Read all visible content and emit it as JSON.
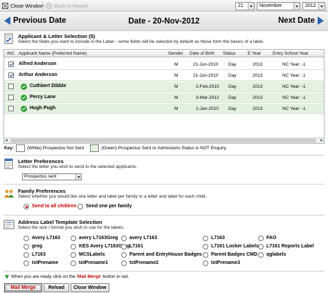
{
  "toolbar": {
    "close_label": "Close Window",
    "back_label": "Back to Report",
    "day": "21",
    "month": "November",
    "year": "2012"
  },
  "datebar": {
    "prev_label": "Previous Date",
    "title": "Date - 20-Nov-2012",
    "next_label": "Next Date"
  },
  "applicants": {
    "title": "Applicant & Letter Selection (5)",
    "description": "Select the fields you want to include in the Label - some fields will be selected by default as these form the basics of a label.",
    "columns": [
      "INC",
      "Applicant Name (Preferred Name)",
      "Gender",
      "Date of Birth",
      "Status",
      "E Year",
      "Entry School Year"
    ],
    "rows": [
      {
        "name": "Alfred Anderson",
        "gender": "M",
        "dob": "21-Jun-2010",
        "status": "Day",
        "eyear": "2013",
        "entry": "NC Year: -1",
        "checked": true,
        "prospectus": false
      },
      {
        "name": "Arthur Anderson",
        "gender": "M",
        "dob": "21-Jun-2010",
        "status": "Day",
        "eyear": "2013",
        "entry": "NC Year: -1",
        "checked": true,
        "prospectus": false
      },
      {
        "name": "Cuthbert Dibble",
        "gender": "M",
        "dob": "2-Feb-2010",
        "status": "Day",
        "eyear": "2013",
        "entry": "NC Year: -1",
        "checked": false,
        "prospectus": true
      },
      {
        "name": "Percy Lane",
        "gender": "M",
        "dob": "3-Mar-2012",
        "status": "Day",
        "eyear": "2013",
        "entry": "NC Year: -1",
        "checked": false,
        "prospectus": true
      },
      {
        "name": "Hugh Pugh",
        "gender": "M",
        "dob": "1-Jan-2010",
        "status": "Day",
        "eyear": "2013",
        "entry": "NC Year: -1",
        "checked": false,
        "prospectus": true
      }
    ]
  },
  "key": {
    "label": "Key:",
    "white_text": "(White) Prospectus Not Sent",
    "green_text": "(Green) Prospectus Sent or Admissions Status is NOT Enquiry."
  },
  "letter": {
    "title": "Letter Preferences",
    "description": "Select the letter you wish to send to the selected applicants.",
    "selected": "Prospectus sent"
  },
  "family": {
    "title": "Family Preferences",
    "description": "Select whether you would like one letter and label per family or a letter and label for each child.",
    "option_all": "Send to all children",
    "option_one": "Send one per family"
  },
  "template": {
    "title": "Address Label Template Selection",
    "description": "Select the size / format you wish to use for the labels.",
    "options": [
      [
        "Avery L7163",
        "avery L7163Greg",
        "avery L7163",
        "L7163",
        "FAO"
      ],
      [
        "greg",
        "KES Avery L7163Greg",
        "L7161",
        "L7161 Locker Labels",
        "L7161 Reports Label"
      ],
      [
        "L7163",
        "MCSLabels",
        "Parent and EntryHouse Badges",
        "Parent Badges CMD",
        "qglabels"
      ],
      [
        "txtPrename",
        "txtPrename1",
        "txtPrename2",
        "txtPrename3"
      ]
    ]
  },
  "footer": {
    "note_prefix": "When you are ready click on the '",
    "note_highlight": "Mail Merge",
    "note_suffix": "' button in red.",
    "mail_merge": "Mail Merge",
    "reload": "Reload",
    "close": "Close Window"
  },
  "colors": {
    "accent": "#2c64b0",
    "green_row": "#e4f1e0",
    "red": "#c00000"
  }
}
